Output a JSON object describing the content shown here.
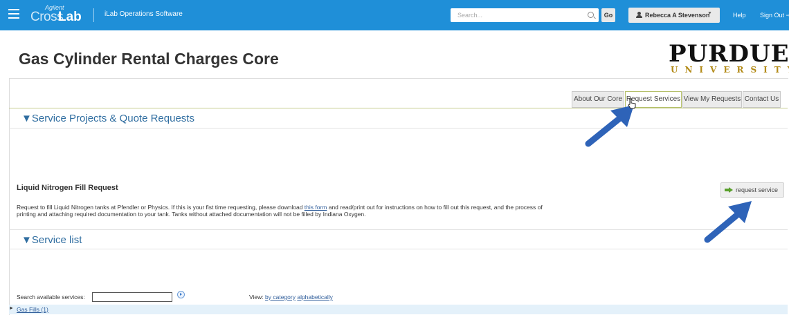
{
  "topbar": {
    "brand_small": "Agilent",
    "brand_cross": "Cross",
    "brand_lab": "Lab",
    "app_name": "iLab Operations Software",
    "search_placeholder": "Search...",
    "go_label": "Go",
    "user_name": "Rebecca A Stevenson",
    "help_label": "Help",
    "signout_label": "Sign Out"
  },
  "page": {
    "title": "Gas Cylinder Rental Charges Core",
    "logo_main": "PURDUE",
    "logo_sub": "UNIVERSITY"
  },
  "tabs": [
    {
      "label": "About Our Core",
      "active": false
    },
    {
      "label": "Request Services",
      "active": true
    },
    {
      "label": "View My Requests",
      "active": false
    },
    {
      "label": "Contact Us",
      "active": false
    }
  ],
  "sections": {
    "projects": "▼Service Projects & Quote Requests",
    "service_list": "▼Service list"
  },
  "request_item": {
    "title": "Liquid Nitrogen Fill Request",
    "desc_before": "Request to fill Liquid Nitrogen tanks at Pfendler or Physics.  If this is your fist time requesting, please download ",
    "desc_link": "this form",
    "desc_after": " and read/print out for instructions on how to fill out this request, and the process of printing and attaching required documentation to your tank.  Tanks without attached documentation will not be filled by Indiana Oxygen.",
    "button_label": "request service"
  },
  "service_search": {
    "label": "Search available services:",
    "view_label": "View:",
    "by_category": "by category",
    "alphabetically": "alphabetically"
  },
  "categories": [
    {
      "label": "Gas Fills (1)"
    }
  ],
  "colors": {
    "topbar": "#1f8fd8",
    "section_heading": "#2f6da0",
    "annotation_arrow": "#2e63b8",
    "purdue_gold": "#b38b18"
  }
}
